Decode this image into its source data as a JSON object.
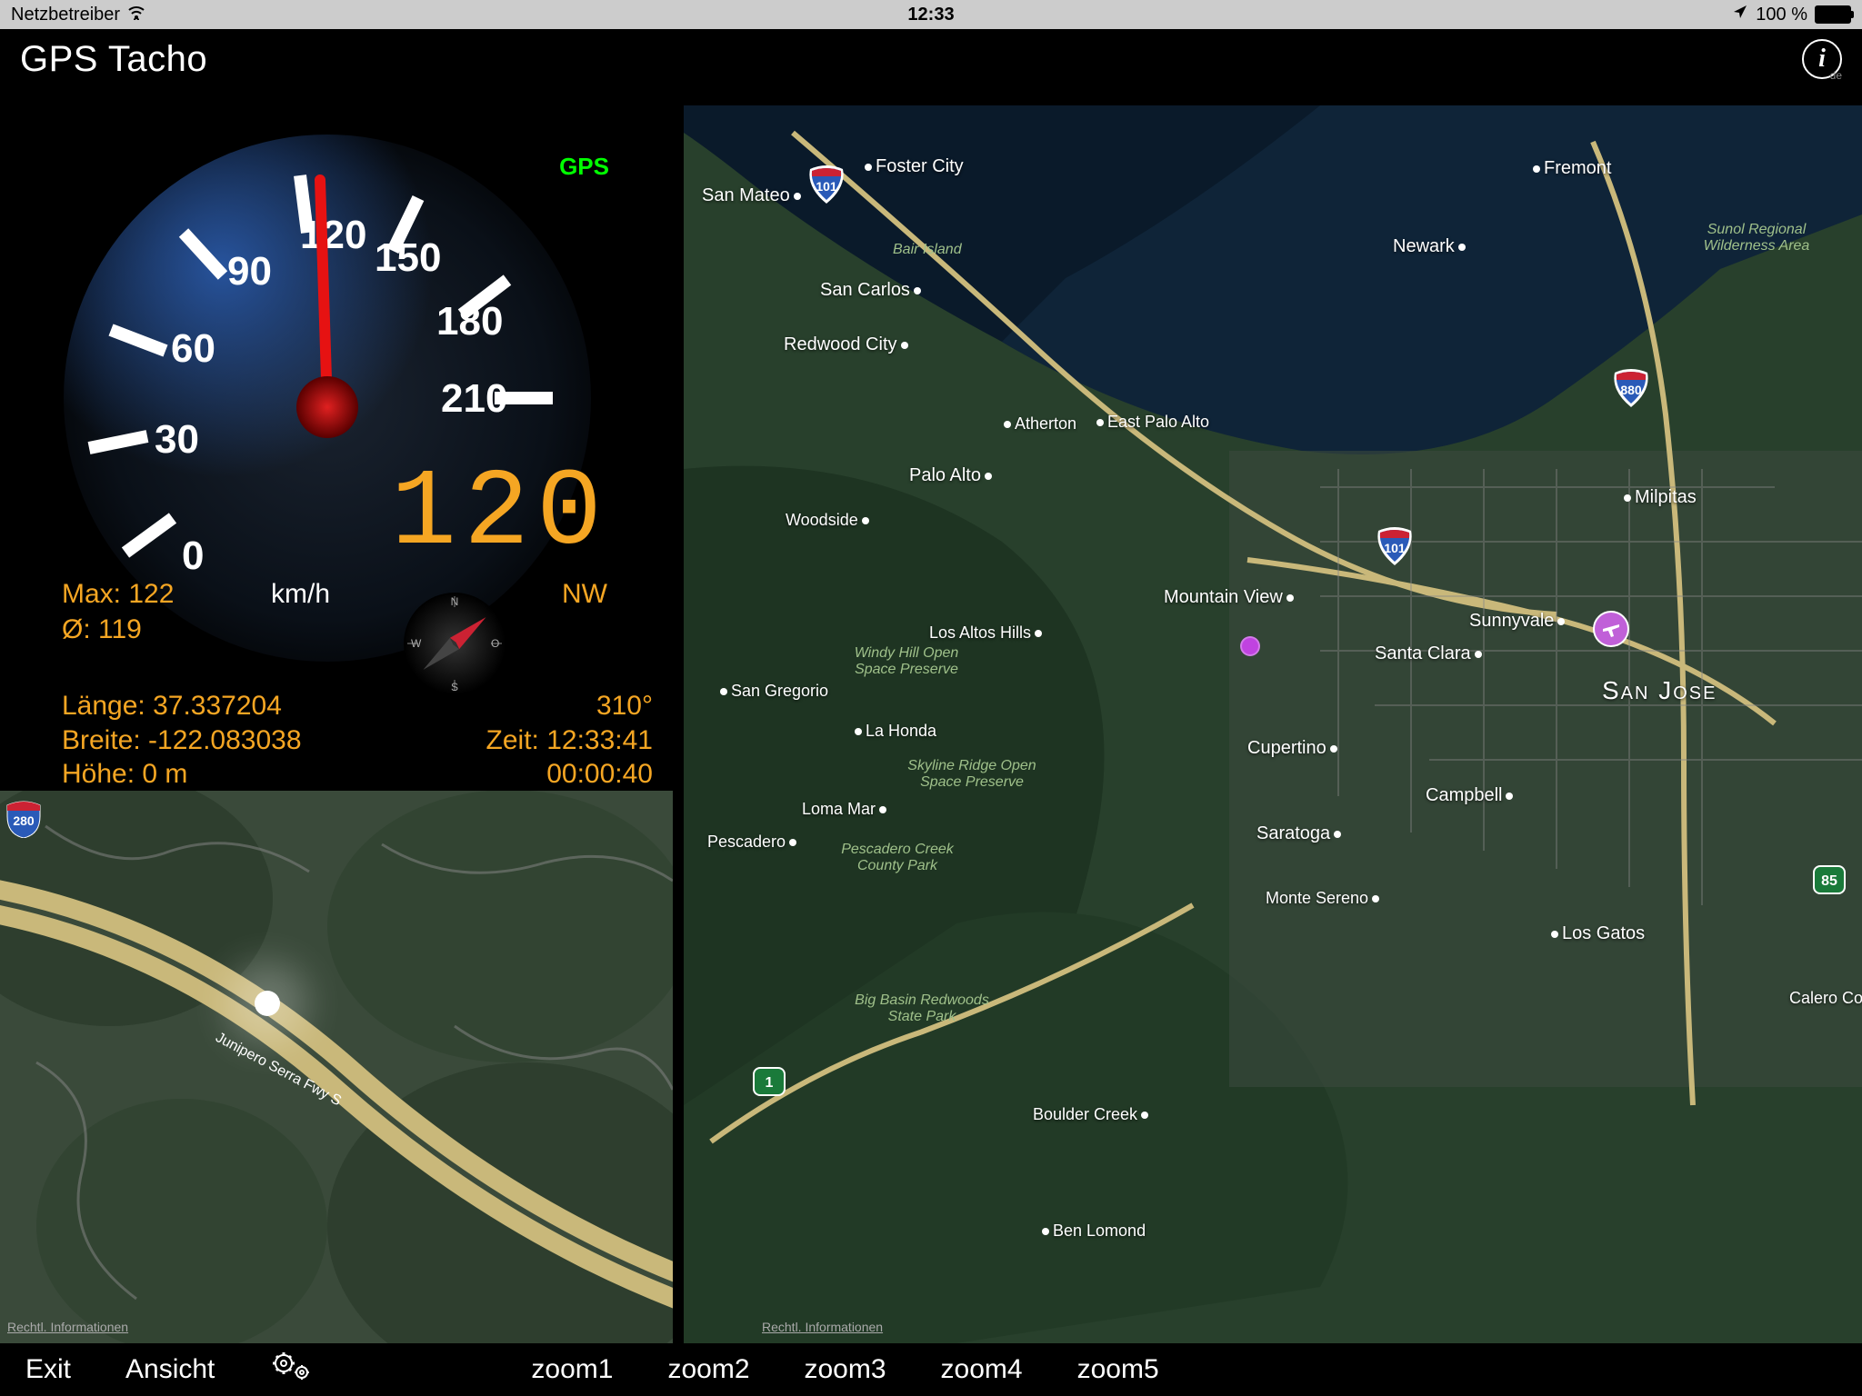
{
  "statusbar": {
    "carrier": "Netzbetreiber",
    "time": "12:33",
    "battery": "100 %"
  },
  "header": {
    "title": "GPS Tacho",
    "lang": "de"
  },
  "gauge": {
    "gps": "GPS",
    "ticks": [
      "0",
      "30",
      "60",
      "90",
      "120",
      "150",
      "180",
      "210"
    ],
    "digital": "120",
    "max_label": "Max: 122",
    "avg_label": "Ø: 119",
    "unit": "km/h",
    "direction": "NW",
    "heading": "310°",
    "lon": "Länge: 37.337204",
    "lat": "Breite: -122.083038",
    "alt": "Höhe: 0 m",
    "time_label": "Zeit: 12:33:41",
    "elapsed": "00:00:40"
  },
  "minimap": {
    "legal": "Rechtl. Informationen",
    "road": "Junipero Serra Fwy S",
    "shield": "280"
  },
  "bigmap": {
    "legal": "Rechtl. Informationen",
    "cities": [
      "Foster City",
      "San Mateo",
      "Fremont",
      "Newark",
      "San Carlos",
      "Redwood City",
      "Atherton",
      "East Palo Alto",
      "Palo Alto",
      "Woodside",
      "Milpitas",
      "Mountain View",
      "Sunnyvale",
      "Los Altos Hills",
      "Santa Clara",
      "San Jose",
      "San Gregorio",
      "La Honda",
      "Cupertino",
      "Campbell",
      "Loma Mar",
      "Pescadero",
      "Saratoga",
      "Monte Sereno",
      "Los Gatos",
      "Boulder Creek",
      "Ben Lomond",
      "Calero Co"
    ],
    "parks": [
      "Bair Island",
      "Sunol Regional Wilderness Area",
      "Windy Hill Open Space Preserve",
      "Skyline Ridge Open Space Preserve",
      "Pescadero Creek County Park",
      "Big Basin Redwoods State Park"
    ],
    "shields": {
      "101a": "101",
      "101b": "101",
      "880": "880",
      "85": "85",
      "1": "1"
    }
  },
  "toolbar": {
    "exit": "Exit",
    "view": "Ansicht",
    "z1": "zoom1",
    "z2": "zoom2",
    "z3": "zoom3",
    "z4": "zoom4",
    "z5": "zoom5"
  }
}
